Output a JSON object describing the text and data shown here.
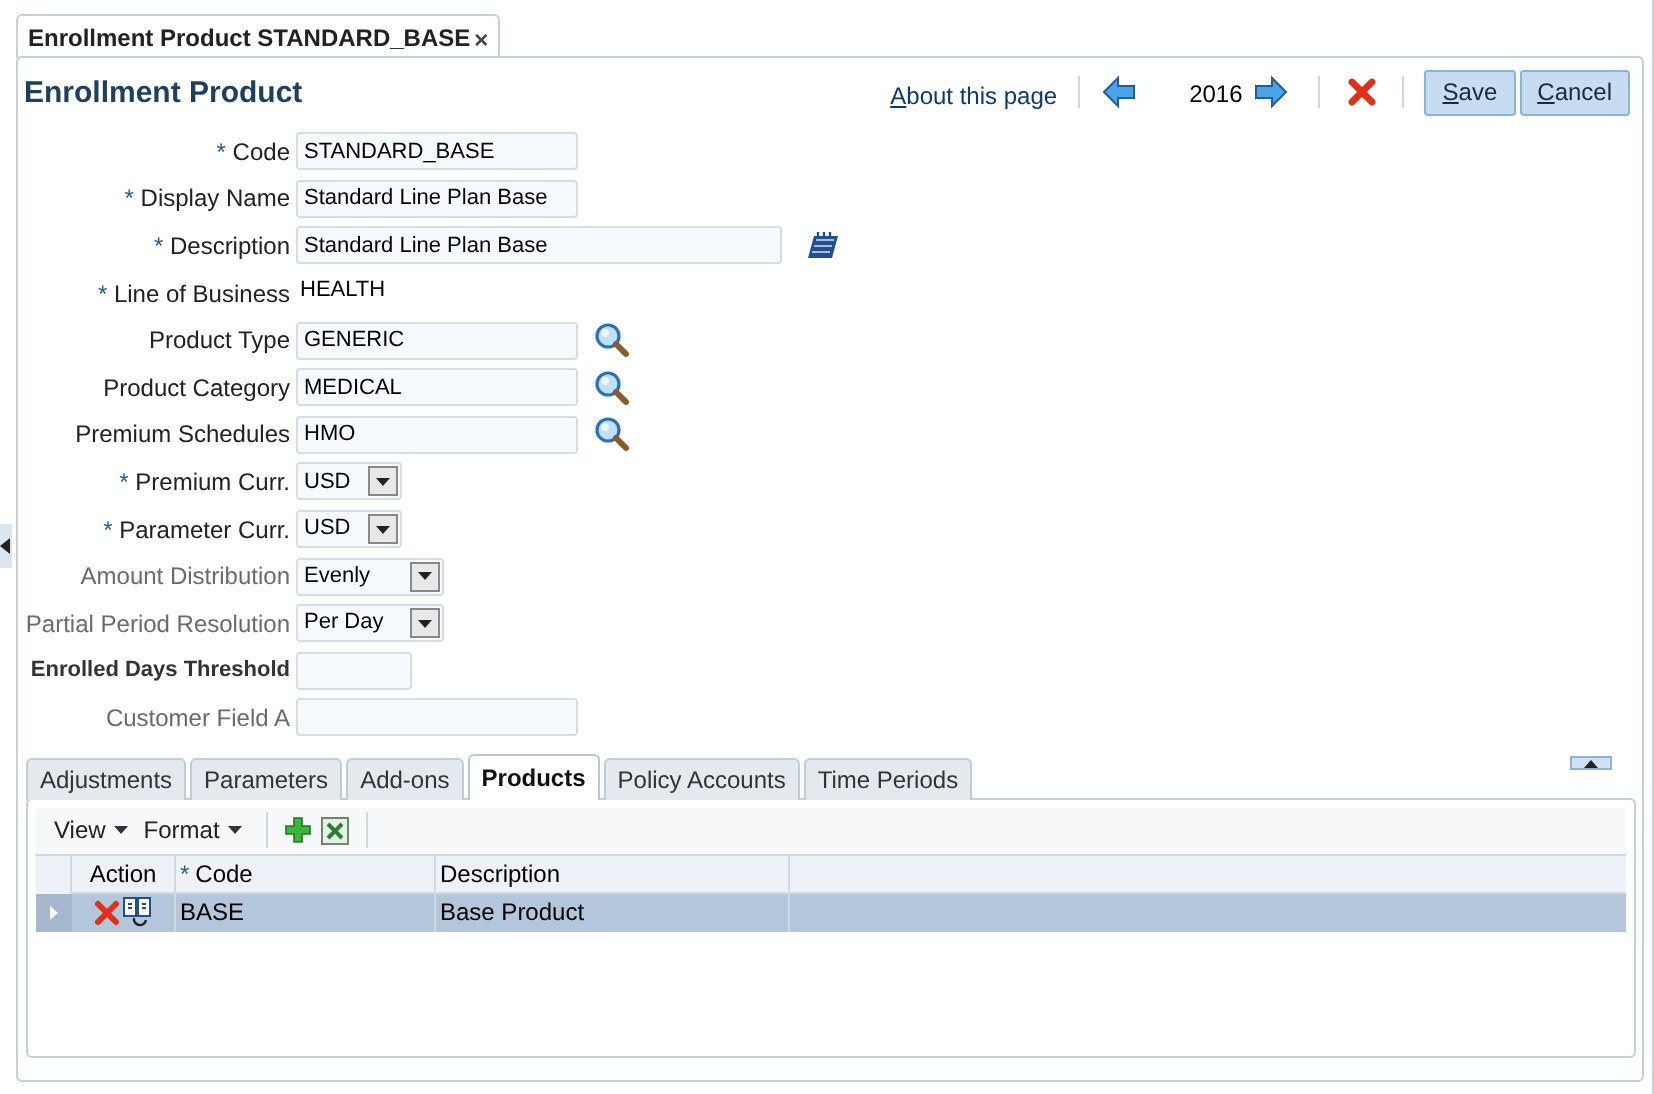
{
  "document_tab": {
    "label": "Enrollment Product STANDARD_BASE",
    "close": "×"
  },
  "title": "Enrollment Product",
  "header_actions": {
    "about_link": "About this page",
    "year": "2016",
    "buttons": [
      "Save",
      "Cancel"
    ]
  },
  "required_mark": "*",
  "fields": [
    {
      "label": "Code",
      "required": true,
      "kind": "text",
      "value": "STANDARD_BASE",
      "disabled": false
    },
    {
      "label": "Display Name",
      "required": true,
      "kind": "text",
      "value": "Standard Line Plan Base",
      "disabled": false
    },
    {
      "label": "Description",
      "required": true,
      "kind": "long_text",
      "value": "Standard Line Plan Base",
      "disabled": false
    },
    {
      "label": "Line of Business",
      "required": true,
      "kind": "readonly",
      "value": "HEALTH",
      "disabled": false
    },
    {
      "label": "Product Type",
      "required": false,
      "kind": "lookup",
      "value": "GENERIC",
      "disabled": false
    },
    {
      "label": "Product Category",
      "required": false,
      "kind": "lookup",
      "value": "MEDICAL",
      "disabled": false
    },
    {
      "label": "Premium Schedules",
      "required": false,
      "kind": "lookup",
      "value": "HMO",
      "disabled": false
    },
    {
      "label": "Premium Curr.",
      "required": true,
      "kind": "select",
      "value": "USD",
      "disabled": false
    },
    {
      "label": "Parameter Curr.",
      "required": true,
      "kind": "select",
      "value": "USD",
      "disabled": false
    },
    {
      "label": "Amount Distribution",
      "required": false,
      "kind": "wide_select",
      "value": "Evenly",
      "disabled": true
    },
    {
      "label": "Partial Period Resolution",
      "required": false,
      "kind": "wide_select",
      "value": "Per Day",
      "disabled": true
    },
    {
      "label": "Enrolled Days Threshold",
      "required": false,
      "kind": "number",
      "disabled": false
    },
    {
      "label": "Customer Field A",
      "required": false,
      "kind": "text",
      "disabled": true
    }
  ],
  "tabs": [
    {
      "label": "Adjustments",
      "selected": false
    },
    {
      "label": "Parameters",
      "selected": false
    },
    {
      "label": "Add-ons",
      "selected": false
    },
    {
      "label": "Products",
      "selected": true
    },
    {
      "label": "Policy Accounts",
      "selected": false
    },
    {
      "label": "Time Periods",
      "selected": false
    }
  ],
  "toolbar": {
    "menus": [
      "View",
      "Format"
    ]
  },
  "table": {
    "columns": [
      {
        "label": "Action",
        "required": false
      },
      {
        "label": "Code",
        "required": true
      },
      {
        "label": "Description",
        "required": false
      }
    ],
    "rows": [
      {
        "code": "BASE",
        "description": "Base Product",
        "selected": true
      }
    ]
  }
}
